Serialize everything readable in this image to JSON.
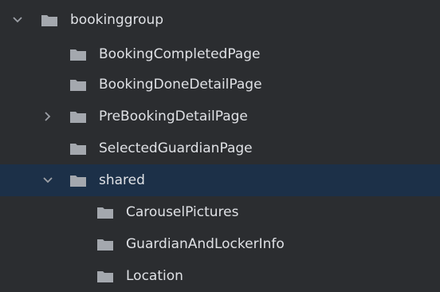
{
  "tree": {
    "root": {
      "label": "bookinggroup",
      "expanded": true,
      "icon": "folder-icon"
    },
    "children": [
      {
        "label": "BookingCompletedPage",
        "icon": "folder-icon"
      },
      {
        "label": "BookingDoneDetailPage",
        "icon": "folder-icon"
      },
      {
        "label": "PreBookingDetailPage",
        "icon": "folder-icon",
        "collapsed": true
      },
      {
        "label": "SelectedGuardianPage",
        "icon": "folder-icon"
      },
      {
        "label": "shared",
        "icon": "folder-icon",
        "expanded": true,
        "selected": true,
        "children": [
          {
            "label": "CarouselPictures",
            "icon": "folder-icon"
          },
          {
            "label": "GuardianAndLockerInfo",
            "icon": "folder-icon"
          },
          {
            "label": "Location",
            "icon": "folder-icon"
          }
        ]
      }
    ]
  },
  "colors": {
    "background": "#2b2d30",
    "selection": "#1c3048",
    "text": "#dfe1e5",
    "folder": "#a4a8ae",
    "arrow": "#9da0a6"
  }
}
